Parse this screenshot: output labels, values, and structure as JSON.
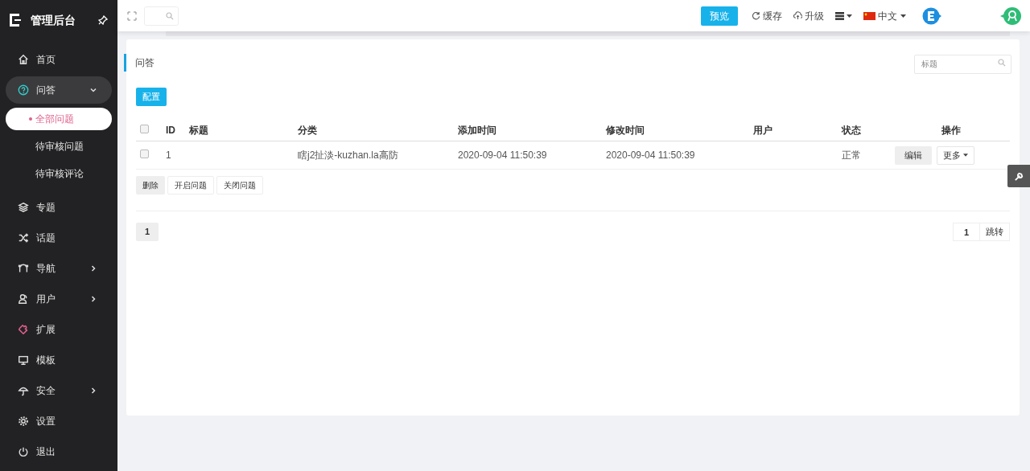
{
  "sidebar": {
    "brand": "管理后台",
    "items": [
      {
        "label": "首页",
        "expandable": false,
        "expanded": false,
        "selected": false
      },
      {
        "label": "问答",
        "expandable": true,
        "expanded": true,
        "selected": false,
        "children": [
          {
            "label": "全部问题",
            "selected": true
          },
          {
            "label": "待审核问题",
            "selected": false
          },
          {
            "label": "待审核评论",
            "selected": false
          }
        ]
      },
      {
        "label": "专题",
        "expandable": false,
        "expanded": false,
        "selected": false
      },
      {
        "label": "话题",
        "expandable": false,
        "expanded": false,
        "selected": false
      },
      {
        "label": "导航",
        "expandable": true,
        "expanded": false,
        "selected": false
      },
      {
        "label": "用户",
        "expandable": true,
        "expanded": false,
        "selected": false
      },
      {
        "label": "扩展",
        "expandable": false,
        "expanded": false,
        "selected": false
      },
      {
        "label": "模板",
        "expandable": false,
        "expanded": false,
        "selected": false
      },
      {
        "label": "安全",
        "expandable": true,
        "expanded": false,
        "selected": false
      },
      {
        "label": "设置",
        "expandable": false,
        "expanded": false,
        "selected": false
      },
      {
        "label": "退出",
        "expandable": false,
        "expanded": false,
        "selected": false
      }
    ]
  },
  "topbar": {
    "preview_button": "预览",
    "cache": "缓存",
    "upgrade": "升级",
    "language": "中文"
  },
  "panel": {
    "title": "问答",
    "search": {
      "placeholder": "标题"
    },
    "config_button": "配置",
    "table": {
      "select_all_checked": false,
      "columns": [
        "",
        "ID",
        "标题",
        "分类",
        "添加时间",
        "修改时间",
        "用户",
        "状态",
        "操作"
      ],
      "rows": [
        {
          "checked": false,
          "id": "1",
          "title": "",
          "category": "瞎j2扯淡-kuzhan.la高防",
          "added": "2020-09-04 11:50:39",
          "modified": "2020-09-04 11:50:39",
          "user": "",
          "status": "正常",
          "actions": [
            "编辑",
            "更多"
          ]
        }
      ]
    },
    "bulk_buttons": [
      "删除",
      "开启问题",
      "关闭问题"
    ],
    "pages": [
      {
        "label": "1",
        "selected": true
      }
    ],
    "jump": {
      "value": "1",
      "button": "跳转"
    }
  }
}
